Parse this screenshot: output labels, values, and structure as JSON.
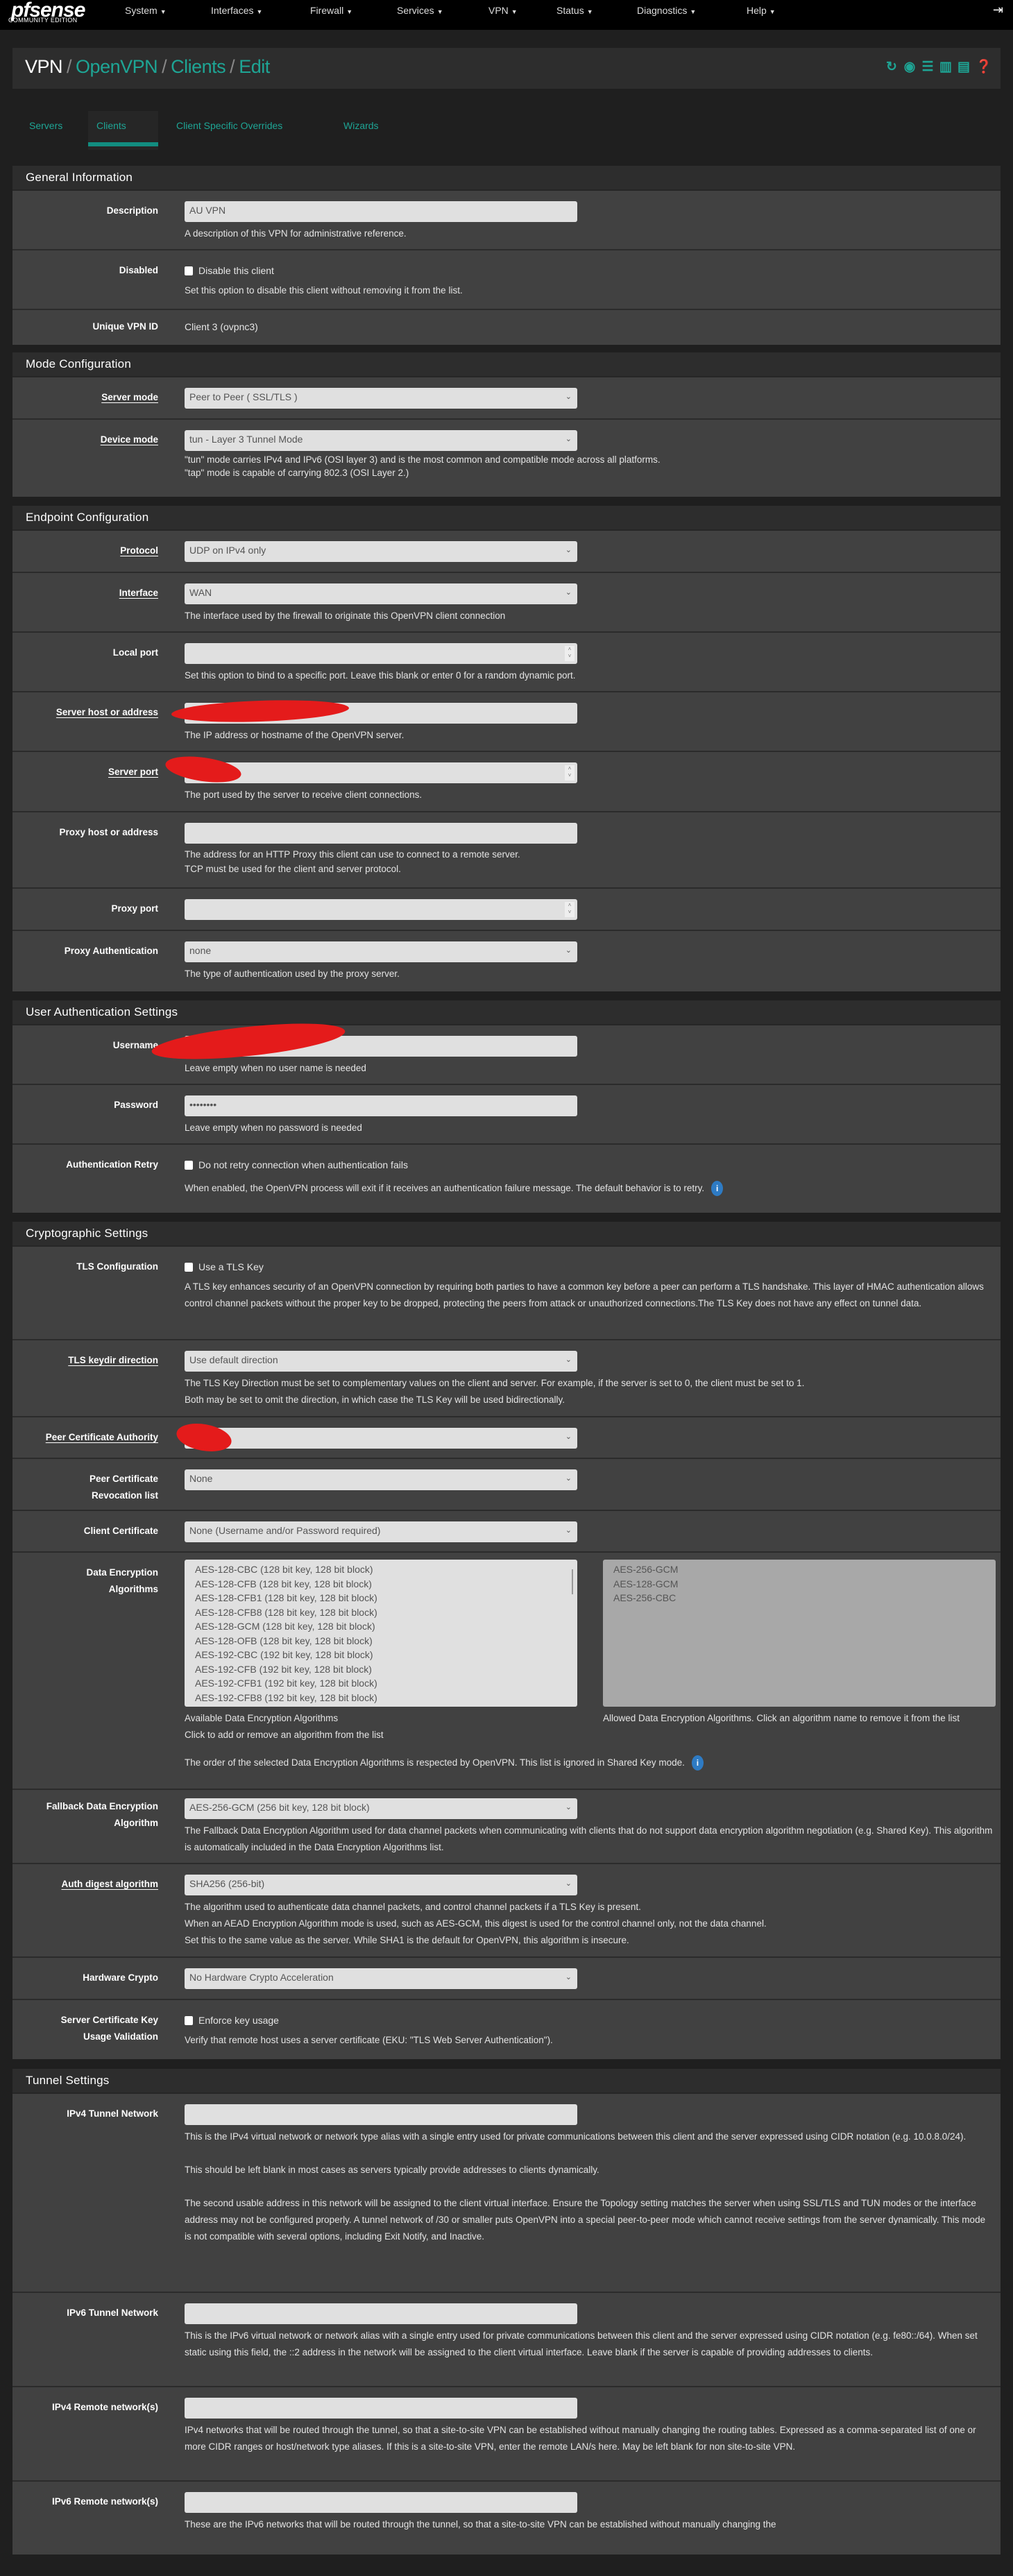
{
  "nav": {
    "logo": "pfsense",
    "edition": "COMMUNITY EDITION",
    "items": [
      "System",
      "Interfaces",
      "Firewall",
      "Services",
      "VPN",
      "Status",
      "Diagnostics",
      "Help"
    ],
    "logout_icon": "sign-out-icon"
  },
  "breadcrumb": [
    "VPN",
    "OpenVPN",
    "Clients",
    "Edit"
  ],
  "title_icons": [
    "restart-icon",
    "stop-icon",
    "settings-sliders-icon",
    "chart-icon",
    "log-icon",
    "help-icon"
  ],
  "tabs": [
    {
      "label": "Servers"
    },
    {
      "label": "Clients",
      "active": true
    },
    {
      "label": "Client Specific Overrides"
    },
    {
      "label": "Wizards"
    }
  ],
  "colors": {
    "accent": "#1ea595",
    "panel": "#414141",
    "header": "#2d2d2d",
    "info": "#2e7bc4"
  },
  "general": {
    "title": "General Information",
    "description": {
      "label": "Description",
      "value": "AU VPN",
      "help": "A description of this VPN for administrative reference."
    },
    "disabled": {
      "label": "Disabled",
      "checkbox": "Disable this client",
      "checked": false,
      "help": "Set this option to disable this client without removing it from the list."
    },
    "unique": {
      "label": "Unique VPN ID",
      "value": "Client 3 (ovpnc3)"
    }
  },
  "mode": {
    "title": "Mode Configuration",
    "server_mode": {
      "label": "Server mode",
      "value": "Peer to Peer ( SSL/TLS )"
    },
    "device_mode": {
      "label": "Device mode",
      "value": "tun - Layer 3 Tunnel Mode",
      "help1": "\"tun\" mode carries IPv4 and IPv6 (OSI layer 3) and is the most common and compatible mode across all platforms.",
      "help2": "\"tap\" mode is capable of carrying 802.3 (OSI Layer 2.)"
    }
  },
  "endpoint": {
    "title": "Endpoint Configuration",
    "protocol": {
      "label": "Protocol",
      "value": "UDP on IPv4 only"
    },
    "interface": {
      "label": "Interface",
      "value": "WAN",
      "help": "The interface used by the firewall to originate this OpenVPN client connection"
    },
    "local_port": {
      "label": "Local port",
      "help": "Set this option to bind to a specific port. Leave this blank or enter 0 for a random dynamic port."
    },
    "server_host": {
      "label": "Server host or address",
      "help": "The IP address or hostname of the OpenVPN server."
    },
    "server_port": {
      "label": "Server port",
      "help": "The port used by the server to receive client connections."
    },
    "proxy_host": {
      "label": "Proxy host or address",
      "help1": "The address for an HTTP Proxy this client can use to connect to a remote server.",
      "help2": "TCP must be used for the client and server protocol."
    },
    "proxy_port": {
      "label": "Proxy port"
    },
    "proxy_auth": {
      "label": "Proxy Authentication",
      "value": "none",
      "help": "The type of authentication used by the proxy server."
    }
  },
  "userauth": {
    "title": "User Authentication Settings",
    "username": {
      "label": "Username",
      "help": "Leave empty when no user name is needed"
    },
    "password": {
      "label": "Password",
      "value": "••••••••",
      "help": "Leave empty when no password is needed"
    },
    "retry": {
      "label": "Authentication Retry",
      "checkbox": "Do not retry connection when authentication fails",
      "checked": false,
      "help": "When enabled, the OpenVPN process will exit if it receives an authentication failure message. The default behavior is to retry."
    }
  },
  "crypto": {
    "title": "Cryptographic Settings",
    "tls": {
      "label": "TLS Configuration",
      "checkbox": "Use a TLS Key",
      "checked": false,
      "help": "A TLS key enhances security of an OpenVPN connection by requiring both parties to have a common key before a peer can perform a TLS handshake. This layer of HMAC authentication allows control channel packets without the proper key to be dropped, protecting the peers from attack or unauthorized connections.The TLS Key does not have any effect on tunnel data."
    },
    "keydir": {
      "label": "TLS keydir direction",
      "value": "Use default direction",
      "help1": "The TLS Key Direction must be set to complementary values on the client and server. For example, if the server is set to 0, the client must be set to 1.",
      "help2": "Both may be set to omit the direction, in which case the TLS Key will be used bidirectionally."
    },
    "peer_ca": {
      "label": "Peer Certificate Authority"
    },
    "crl": {
      "label1": "Peer Certificate",
      "label2": "Revocation list",
      "value": "None"
    },
    "client_cert": {
      "label": "Client Certificate",
      "value": "None (Username and/or Password required)"
    },
    "data_enc": {
      "label1": "Data Encryption",
      "label2": "Algorithms",
      "available": [
        "AES-128-CBC (128 bit key, 128 bit block)",
        "AES-128-CFB (128 bit key, 128 bit block)",
        "AES-128-CFB1 (128 bit key, 128 bit block)",
        "AES-128-CFB8 (128 bit key, 128 bit block)",
        "AES-128-GCM (128 bit key, 128 bit block)",
        "AES-128-OFB (128 bit key, 128 bit block)",
        "AES-192-CBC (192 bit key, 128 bit block)",
        "AES-192-CFB (192 bit key, 128 bit block)",
        "AES-192-CFB1 (192 bit key, 128 bit block)",
        "AES-192-CFB8 (192 bit key, 128 bit block)"
      ],
      "allowed": [
        "AES-256-GCM",
        "AES-128-GCM",
        "AES-256-CBC"
      ],
      "available_help1": "Available Data Encryption Algorithms",
      "available_help2": "Click to add or remove an algorithm from the list",
      "allowed_help": "Allowed Data Encryption Algorithms. Click an algorithm name to remove it from the list",
      "order_help": "The order of the selected Data Encryption Algorithms is respected by OpenVPN. This list is ignored in Shared Key mode."
    },
    "fallback": {
      "label1": "Fallback Data Encryption",
      "label2": "Algorithm",
      "value": "AES-256-GCM (256 bit key, 128 bit block)",
      "help": "The Fallback Data Encryption Algorithm used for data channel packets when communicating with clients that do not support data encryption algorithm negotiation (e.g. Shared Key). This algorithm is automatically included in the Data Encryption Algorithms list."
    },
    "digest": {
      "label": "Auth digest algorithm",
      "value": "SHA256 (256-bit)",
      "help1": "The algorithm used to authenticate data channel packets, and control channel packets if a TLS Key is present.",
      "help2": "When an AEAD Encryption Algorithm mode is used, such as AES-GCM, this digest is used for the control channel only, not the data channel.",
      "help3": "Set this to the same value as the server. While SHA1 is the default for OpenVPN, this algorithm is insecure."
    },
    "hw": {
      "label": "Hardware Crypto",
      "value": "No Hardware Crypto Acceleration"
    },
    "eku": {
      "label1": "Server Certificate Key",
      "label2": "Usage Validation",
      "checkbox": "Enforce key usage",
      "checked": false,
      "help": "Verify that remote host uses a server certificate (EKU: \"TLS Web Server Authentication\")."
    }
  },
  "tunnel": {
    "title": "Tunnel Settings",
    "ipv4_tunnel": {
      "label": "IPv4 Tunnel Network",
      "help1": "This is the IPv4 virtual network or network type alias with a single entry used for private communications between this client and the server expressed using CIDR notation (e.g. 10.0.8.0/24).",
      "help2": "This should be left blank in most cases as servers typically provide addresses to clients dynamically.",
      "help3": "The second usable address in this network will be assigned to the client virtual interface. Ensure the Topology setting matches the server when using SSL/TLS and TUN modes or the interface address may not be configured properly. A tunnel network of /30 or smaller puts OpenVPN into a special peer-to-peer mode which cannot receive settings from the server dynamically. This mode is not compatible with several options, including Exit Notify, and Inactive."
    },
    "ipv6_tunnel": {
      "label": "IPv6 Tunnel Network",
      "help": "This is the IPv6 virtual network or network alias with a single entry used for private communications between this client and the server expressed using CIDR notation (e.g. fe80::/64). When set static using this field, the ::2 address in the network will be assigned to the client virtual interface. Leave blank if the server is capable of providing addresses to clients."
    },
    "ipv4_remote": {
      "label": "IPv4 Remote network(s)",
      "help": "IPv4 networks that will be routed through the tunnel, so that a site-to-site VPN can be established without manually changing the routing tables. Expressed as a comma-separated list of one or more CIDR ranges or host/network type aliases. If this is a site-to-site VPN, enter the remote LAN/s here. May be left blank for non site-to-site VPN."
    },
    "ipv6_remote": {
      "label": "IPv6 Remote network(s)",
      "help": "These are the IPv6 networks that will be routed through the tunnel, so that a site-to-site VPN can be established without manually changing the"
    }
  }
}
